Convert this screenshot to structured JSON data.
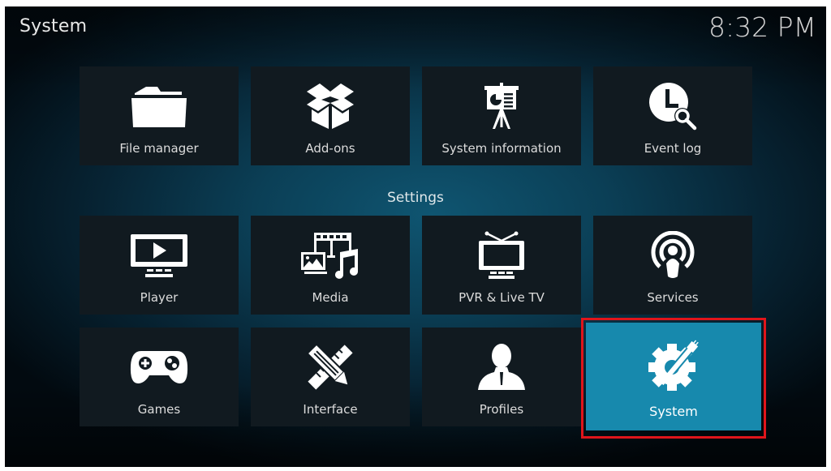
{
  "header": {
    "title": "System",
    "clock": "8:32 PM"
  },
  "top_row": [
    {
      "label": "File manager",
      "icon": "folder-icon"
    },
    {
      "label": "Add-ons",
      "icon": "open-box-icon"
    },
    {
      "label": "System information",
      "icon": "presentation-easel-icon"
    },
    {
      "label": "Event log",
      "icon": "clock-search-icon"
    }
  ],
  "settings": {
    "title": "Settings",
    "items": [
      {
        "label": "Player",
        "icon": "monitor-play-icon"
      },
      {
        "label": "Media",
        "icon": "media-film-photo-music-icon"
      },
      {
        "label": "PVR & Live TV",
        "icon": "tv-antenna-icon"
      },
      {
        "label": "Services",
        "icon": "broadcast-person-icon"
      },
      {
        "label": "Games",
        "icon": "gamepad-icon"
      },
      {
        "label": "Interface",
        "icon": "pencil-ruler-icon"
      },
      {
        "label": "Profiles",
        "icon": "user-silhouette-icon"
      },
      {
        "label": "System",
        "icon": "gear-wrench-icon",
        "focused": true
      }
    ]
  },
  "colors": {
    "focus_tile": "#1789ad",
    "tile_bg": "#111a20",
    "highlight_border": "#e0151b"
  }
}
